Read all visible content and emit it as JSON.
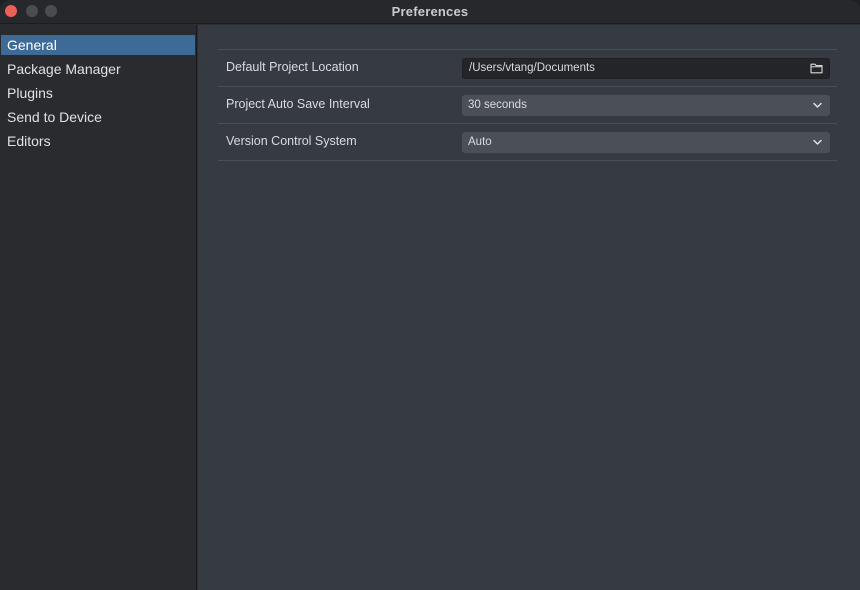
{
  "window": {
    "title": "Preferences"
  },
  "sidebar": {
    "items": [
      {
        "label": "General",
        "active": true
      },
      {
        "label": "Package Manager",
        "active": false
      },
      {
        "label": "Plugins",
        "active": false
      },
      {
        "label": "Send to Device",
        "active": false
      },
      {
        "label": "Editors",
        "active": false
      }
    ]
  },
  "preferences": {
    "project_location": {
      "label": "Default Project Location",
      "value": "/Users/vtang/Documents",
      "icon": "folder-icon"
    },
    "auto_save": {
      "label": "Project Auto Save Interval",
      "value": "30 seconds",
      "icon": "chevron-down-icon"
    },
    "version_control": {
      "label": "Version Control System",
      "value": "Auto",
      "icon": "chevron-down-icon"
    }
  },
  "colors": {
    "accent": "#3e6b95",
    "close_button": "#ed5f57"
  }
}
